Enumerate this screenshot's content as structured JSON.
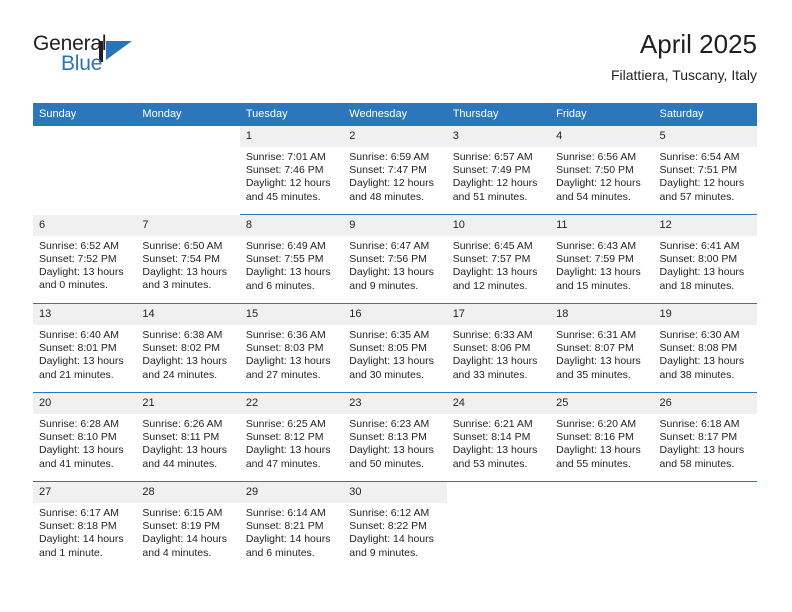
{
  "brand": {
    "name_top": "General",
    "name_bottom": "Blue",
    "mark": "triangle-logo-icon",
    "color_blue": "#2b74b8",
    "color_dark": "#231f20"
  },
  "header": {
    "title": "April 2025",
    "subtitle": "Filattiera, Tuscany, Italy"
  },
  "theme": {
    "header_blue": "#2c76bb",
    "daynum_band": "#f0f0f0",
    "text": "#231f20"
  },
  "calendar": {
    "weekday_headers": [
      "Sunday",
      "Monday",
      "Tuesday",
      "Wednesday",
      "Thursday",
      "Friday",
      "Saturday"
    ],
    "weeks": [
      [
        {
          "day": "",
          "sunrise": "",
          "sunset": "",
          "daylight1": "",
          "daylight2": "",
          "empty": true
        },
        {
          "day": "",
          "sunrise": "",
          "sunset": "",
          "daylight1": "",
          "daylight2": "",
          "empty": true
        },
        {
          "day": "1",
          "sunrise": "Sunrise: 7:01 AM",
          "sunset": "Sunset: 7:46 PM",
          "daylight1": "Daylight: 12 hours",
          "daylight2": "and 45 minutes."
        },
        {
          "day": "2",
          "sunrise": "Sunrise: 6:59 AM",
          "sunset": "Sunset: 7:47 PM",
          "daylight1": "Daylight: 12 hours",
          "daylight2": "and 48 minutes."
        },
        {
          "day": "3",
          "sunrise": "Sunrise: 6:57 AM",
          "sunset": "Sunset: 7:49 PM",
          "daylight1": "Daylight: 12 hours",
          "daylight2": "and 51 minutes."
        },
        {
          "day": "4",
          "sunrise": "Sunrise: 6:56 AM",
          "sunset": "Sunset: 7:50 PM",
          "daylight1": "Daylight: 12 hours",
          "daylight2": "and 54 minutes."
        },
        {
          "day": "5",
          "sunrise": "Sunrise: 6:54 AM",
          "sunset": "Sunset: 7:51 PM",
          "daylight1": "Daylight: 12 hours",
          "daylight2": "and 57 minutes."
        }
      ],
      [
        {
          "day": "6",
          "sunrise": "Sunrise: 6:52 AM",
          "sunset": "Sunset: 7:52 PM",
          "daylight1": "Daylight: 13 hours",
          "daylight2": "and 0 minutes."
        },
        {
          "day": "7",
          "sunrise": "Sunrise: 6:50 AM",
          "sunset": "Sunset: 7:54 PM",
          "daylight1": "Daylight: 13 hours",
          "daylight2": "and 3 minutes."
        },
        {
          "day": "8",
          "sunrise": "Sunrise: 6:49 AM",
          "sunset": "Sunset: 7:55 PM",
          "daylight1": "Daylight: 13 hours",
          "daylight2": "and 6 minutes."
        },
        {
          "day": "9",
          "sunrise": "Sunrise: 6:47 AM",
          "sunset": "Sunset: 7:56 PM",
          "daylight1": "Daylight: 13 hours",
          "daylight2": "and 9 minutes."
        },
        {
          "day": "10",
          "sunrise": "Sunrise: 6:45 AM",
          "sunset": "Sunset: 7:57 PM",
          "daylight1": "Daylight: 13 hours",
          "daylight2": "and 12 minutes."
        },
        {
          "day": "11",
          "sunrise": "Sunrise: 6:43 AM",
          "sunset": "Sunset: 7:59 PM",
          "daylight1": "Daylight: 13 hours",
          "daylight2": "and 15 minutes."
        },
        {
          "day": "12",
          "sunrise": "Sunrise: 6:41 AM",
          "sunset": "Sunset: 8:00 PM",
          "daylight1": "Daylight: 13 hours",
          "daylight2": "and 18 minutes."
        }
      ],
      [
        {
          "day": "13",
          "sunrise": "Sunrise: 6:40 AM",
          "sunset": "Sunset: 8:01 PM",
          "daylight1": "Daylight: 13 hours",
          "daylight2": "and 21 minutes."
        },
        {
          "day": "14",
          "sunrise": "Sunrise: 6:38 AM",
          "sunset": "Sunset: 8:02 PM",
          "daylight1": "Daylight: 13 hours",
          "daylight2": "and 24 minutes."
        },
        {
          "day": "15",
          "sunrise": "Sunrise: 6:36 AM",
          "sunset": "Sunset: 8:03 PM",
          "daylight1": "Daylight: 13 hours",
          "daylight2": "and 27 minutes."
        },
        {
          "day": "16",
          "sunrise": "Sunrise: 6:35 AM",
          "sunset": "Sunset: 8:05 PM",
          "daylight1": "Daylight: 13 hours",
          "daylight2": "and 30 minutes."
        },
        {
          "day": "17",
          "sunrise": "Sunrise: 6:33 AM",
          "sunset": "Sunset: 8:06 PM",
          "daylight1": "Daylight: 13 hours",
          "daylight2": "and 33 minutes."
        },
        {
          "day": "18",
          "sunrise": "Sunrise: 6:31 AM",
          "sunset": "Sunset: 8:07 PM",
          "daylight1": "Daylight: 13 hours",
          "daylight2": "and 35 minutes."
        },
        {
          "day": "19",
          "sunrise": "Sunrise: 6:30 AM",
          "sunset": "Sunset: 8:08 PM",
          "daylight1": "Daylight: 13 hours",
          "daylight2": "and 38 minutes."
        }
      ],
      [
        {
          "day": "20",
          "sunrise": "Sunrise: 6:28 AM",
          "sunset": "Sunset: 8:10 PM",
          "daylight1": "Daylight: 13 hours",
          "daylight2": "and 41 minutes."
        },
        {
          "day": "21",
          "sunrise": "Sunrise: 6:26 AM",
          "sunset": "Sunset: 8:11 PM",
          "daylight1": "Daylight: 13 hours",
          "daylight2": "and 44 minutes."
        },
        {
          "day": "22",
          "sunrise": "Sunrise: 6:25 AM",
          "sunset": "Sunset: 8:12 PM",
          "daylight1": "Daylight: 13 hours",
          "daylight2": "and 47 minutes."
        },
        {
          "day": "23",
          "sunrise": "Sunrise: 6:23 AM",
          "sunset": "Sunset: 8:13 PM",
          "daylight1": "Daylight: 13 hours",
          "daylight2": "and 50 minutes."
        },
        {
          "day": "24",
          "sunrise": "Sunrise: 6:21 AM",
          "sunset": "Sunset: 8:14 PM",
          "daylight1": "Daylight: 13 hours",
          "daylight2": "and 53 minutes."
        },
        {
          "day": "25",
          "sunrise": "Sunrise: 6:20 AM",
          "sunset": "Sunset: 8:16 PM",
          "daylight1": "Daylight: 13 hours",
          "daylight2": "and 55 minutes."
        },
        {
          "day": "26",
          "sunrise": "Sunrise: 6:18 AM",
          "sunset": "Sunset: 8:17 PM",
          "daylight1": "Daylight: 13 hours",
          "daylight2": "and 58 minutes."
        }
      ],
      [
        {
          "day": "27",
          "sunrise": "Sunrise: 6:17 AM",
          "sunset": "Sunset: 8:18 PM",
          "daylight1": "Daylight: 14 hours",
          "daylight2": "and 1 minute."
        },
        {
          "day": "28",
          "sunrise": "Sunrise: 6:15 AM",
          "sunset": "Sunset: 8:19 PM",
          "daylight1": "Daylight: 14 hours",
          "daylight2": "and 4 minutes."
        },
        {
          "day": "29",
          "sunrise": "Sunrise: 6:14 AM",
          "sunset": "Sunset: 8:21 PM",
          "daylight1": "Daylight: 14 hours",
          "daylight2": "and 6 minutes."
        },
        {
          "day": "30",
          "sunrise": "Sunrise: 6:12 AM",
          "sunset": "Sunset: 8:22 PM",
          "daylight1": "Daylight: 14 hours",
          "daylight2": "and 9 minutes."
        },
        {
          "day": "",
          "sunrise": "",
          "sunset": "",
          "daylight1": "",
          "daylight2": "",
          "empty": true
        },
        {
          "day": "",
          "sunrise": "",
          "sunset": "",
          "daylight1": "",
          "daylight2": "",
          "empty": true
        },
        {
          "day": "",
          "sunrise": "",
          "sunset": "",
          "daylight1": "",
          "daylight2": "",
          "empty": true
        }
      ]
    ]
  }
}
